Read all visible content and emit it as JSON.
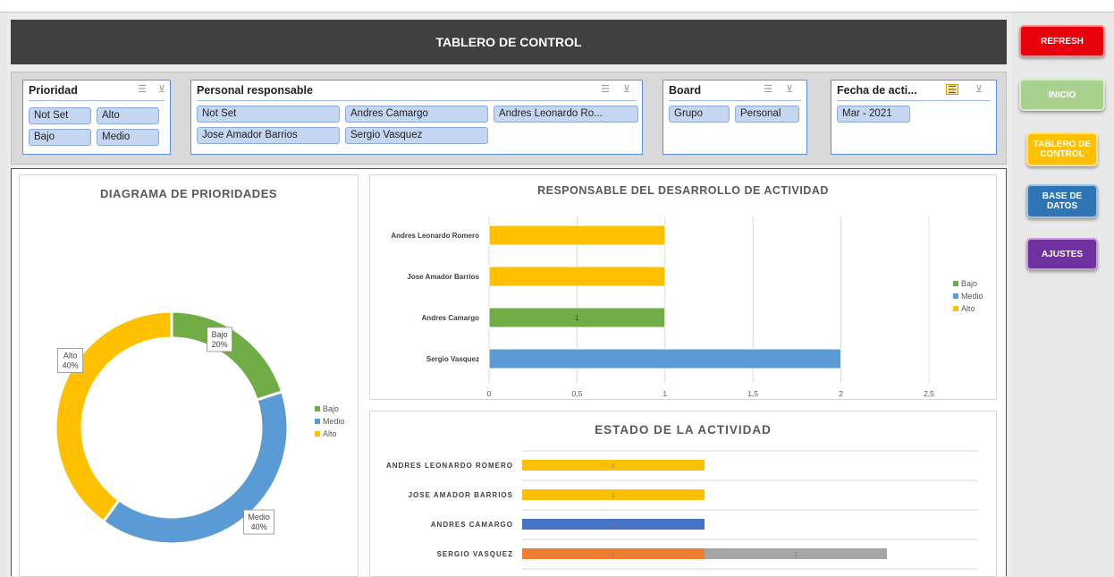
{
  "title": "TABLERO DE CONTROL",
  "slicers": {
    "prioridad": {
      "title": "Prioridad",
      "items": [
        "Not Set",
        "Alto",
        "Bajo",
        "Medio"
      ]
    },
    "personal": {
      "title": "Personal responsable",
      "items": [
        "Not Set",
        "Andres Camargo",
        "Andres Leonardo Ro...",
        "Jose Amador Barrios",
        "Sergio Vasquez"
      ]
    },
    "board": {
      "title": "Board",
      "items": [
        "Grupo",
        "Personal"
      ]
    },
    "fecha": {
      "title": "Fecha de acti...",
      "items": [
        "Mar - 2021"
      ]
    }
  },
  "buttons": {
    "refresh": "REFRESH",
    "inicio": "INICIO",
    "tablero": "TABLERO DE CONTROL",
    "base": "BASE DE DATOS",
    "ajustes": "AJUSTES"
  },
  "colors": {
    "bajo": "#70ad47",
    "medio": "#5b9bd5",
    "alto": "#ffc000",
    "orange": "#ed7d31",
    "gray": "#a5a5a5",
    "darkblue": "#4472c4"
  },
  "chart_data": [
    {
      "type": "pie",
      "title": "DIAGRAMA DE PRIORIDADES",
      "categories": [
        "Bajo",
        "Medio",
        "Alto"
      ],
      "values": [
        20,
        40,
        40
      ],
      "labels": [
        "Bajo\n20%",
        "Medio\n40%",
        "Alto\n40%"
      ],
      "legend": [
        "Bajo",
        "Medio",
        "Alto"
      ],
      "legend_position": "right"
    },
    {
      "type": "bar",
      "orientation": "horizontal",
      "title": "RESPONSABLE DEL DESARROLLO DE ACTIVIDAD",
      "categories": [
        "Andres Leonardo Romero",
        "Jose Amador Barrios",
        "Andres Camargo",
        "Sergio Vasquez"
      ],
      "series": [
        {
          "name": "Bajo",
          "values": [
            0,
            0,
            1,
            0
          ]
        },
        {
          "name": "Medio",
          "values": [
            0,
            0,
            0,
            2
          ]
        },
        {
          "name": "Alto",
          "values": [
            1,
            1,
            0,
            0
          ]
        }
      ],
      "data_labels": [
        "",
        "",
        "1",
        ""
      ],
      "xticks": [
        "0",
        "0,5",
        "1",
        "1,5",
        "2",
        "2,5"
      ],
      "xlim": [
        0,
        2.5
      ],
      "legend": [
        "Bajo",
        "Medio",
        "Alto"
      ],
      "legend_position": "right",
      "grid": true
    },
    {
      "type": "bar",
      "orientation": "horizontal",
      "stacked": true,
      "title": "ESTADO DE LA ACTIVIDAD",
      "categories": [
        "ANDRES LEONARDO ROMERO",
        "JOSE AMADOR BARRIOS",
        "ANDRES CAMARGO",
        "SERGIO VASQUEZ"
      ],
      "segments": [
        [
          {
            "value": 1,
            "color": "#ffc000",
            "label": "1"
          }
        ],
        [
          {
            "value": 1,
            "color": "#ffc000",
            "label": "1"
          }
        ],
        [
          {
            "value": 1,
            "color": "#4472c4",
            "label": "1"
          }
        ],
        [
          {
            "value": 1,
            "color": "#ed7d31",
            "label": "1"
          },
          {
            "value": 1,
            "color": "#a5a5a5",
            "label": "1"
          }
        ]
      ],
      "xlim": [
        0,
        2.5
      ],
      "grid": true
    }
  ]
}
